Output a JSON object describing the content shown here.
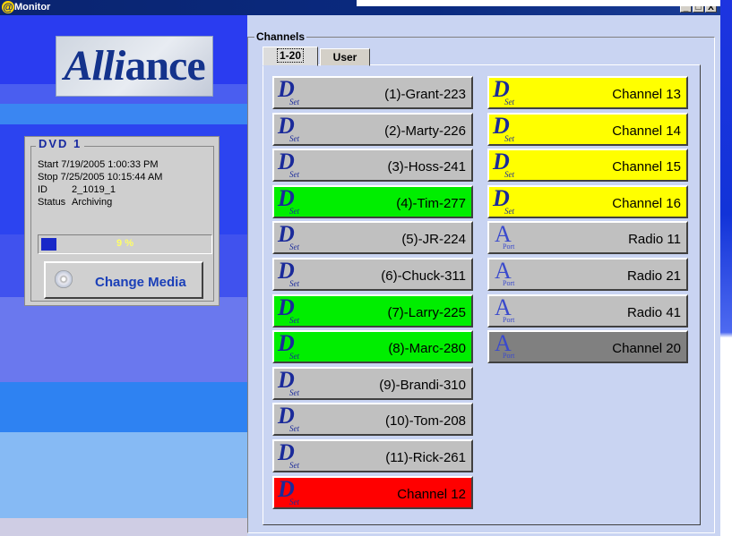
{
  "window": {
    "title": "Monitor",
    "app_icon": "at-sign-icon",
    "controls": {
      "minimize": "_",
      "maximize": "□",
      "close": "X"
    }
  },
  "logo": {
    "text_main": "Alli",
    "text_rest": "ance"
  },
  "dvd": {
    "title": "DVD 1",
    "start": "Start 7/19/2005 1:00:33 PM",
    "stop": "Stop 7/25/2005 10:15:44 AM",
    "id_label": "ID",
    "id_value": "2_1019_1",
    "status_label": "Status",
    "status_value": "Archiving",
    "progress_percent": 9,
    "progress_text": "9 %",
    "change_media_label": "Change Media",
    "change_media_icon": "cd-icon"
  },
  "channels": {
    "group_label": "Channels",
    "tabs": [
      {
        "label": "1-20",
        "selected": true
      },
      {
        "label": "User",
        "selected": false
      }
    ],
    "colors": {
      "gray": "#c0c0c0",
      "green": "#00ee00",
      "yellow": "#ffff00",
      "red": "#ff0000",
      "dark": "#808080"
    },
    "left_column": [
      {
        "glyph": "D",
        "sub": "Set",
        "name": "(1)-Grant-223",
        "color": "gray"
      },
      {
        "glyph": "D",
        "sub": "Set",
        "name": "(2)-Marty-226",
        "color": "gray"
      },
      {
        "glyph": "D",
        "sub": "Set",
        "name": "(3)-Hoss-241",
        "color": "gray"
      },
      {
        "glyph": "D",
        "sub": "Set",
        "name": "(4)-Tim-277",
        "color": "green"
      },
      {
        "glyph": "D",
        "sub": "Set",
        "name": "(5)-JR-224",
        "color": "gray"
      },
      {
        "glyph": "D",
        "sub": "Set",
        "name": "(6)-Chuck-311",
        "color": "gray"
      },
      {
        "glyph": "D",
        "sub": "Set",
        "name": "(7)-Larry-225",
        "color": "green"
      },
      {
        "glyph": "D",
        "sub": "Set",
        "name": "(8)-Marc-280",
        "color": "green"
      },
      {
        "glyph": "D",
        "sub": "Set",
        "name": "(9)-Brandi-310",
        "color": "gray"
      },
      {
        "glyph": "D",
        "sub": "Set",
        "name": "(10)-Tom-208",
        "color": "gray"
      },
      {
        "glyph": "D",
        "sub": "Set",
        "name": "(11)-Rick-261",
        "color": "gray"
      },
      {
        "glyph": "D",
        "sub": "Set",
        "name": "Channel 12",
        "color": "red"
      }
    ],
    "right_column": [
      {
        "glyph": "D",
        "sub": "Set",
        "name": "Channel 13",
        "color": "yellow"
      },
      {
        "glyph": "D",
        "sub": "Set",
        "name": "Channel 14",
        "color": "yellow"
      },
      {
        "glyph": "D",
        "sub": "Set",
        "name": "Channel 15",
        "color": "yellow"
      },
      {
        "glyph": "D",
        "sub": "Set",
        "name": "Channel 16",
        "color": "yellow"
      },
      {
        "glyph": "A",
        "sub": "Port",
        "name": "Radio 11",
        "color": "gray"
      },
      {
        "glyph": "A",
        "sub": "Port",
        "name": "Radio 21",
        "color": "gray"
      },
      {
        "glyph": "A",
        "sub": "Port",
        "name": "Radio 41",
        "color": "gray"
      },
      {
        "glyph": "A",
        "sub": "Port",
        "name": "Channel 20",
        "color": "dark"
      }
    ]
  }
}
